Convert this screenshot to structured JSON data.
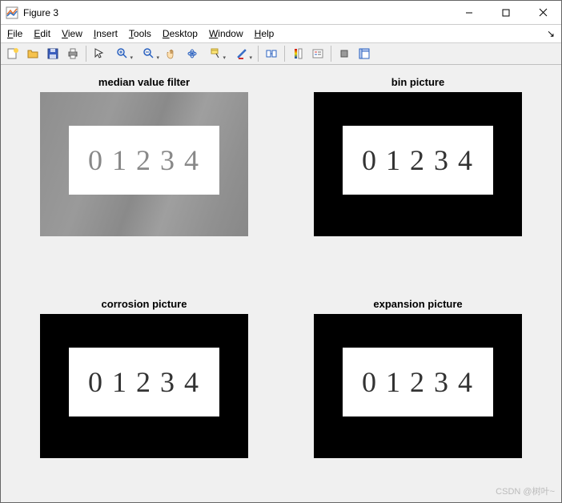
{
  "window": {
    "title": "Figure 3"
  },
  "menu": {
    "items": [
      "File",
      "Edit",
      "View",
      "Insert",
      "Tools",
      "Desktop",
      "Window",
      "Help"
    ]
  },
  "toolbar": {
    "icons": [
      "new-figure-icon",
      "open-file-icon",
      "save-icon",
      "print-icon",
      "sep",
      "pointer-icon",
      "zoom-in-icon",
      "zoom-out-icon",
      "pan-icon",
      "rotate-3d-icon",
      "data-cursor-icon",
      "brush-icon",
      "sep",
      "link-plot-icon",
      "sep",
      "insert-colorbar-icon",
      "insert-legend-icon",
      "sep",
      "hide-plot-tools-icon",
      "show-plot-tools-icon"
    ]
  },
  "subplots": [
    {
      "title": "median value filter",
      "style": "gray",
      "plate_text": "01234"
    },
    {
      "title": "bin picture",
      "style": "black",
      "plate_text": "01234"
    },
    {
      "title": "corrosion picture",
      "style": "black",
      "plate_text": "01234"
    },
    {
      "title": "expansion picture",
      "style": "black",
      "plate_text": "01234"
    }
  ],
  "watermark": "CSDN @树叶~"
}
